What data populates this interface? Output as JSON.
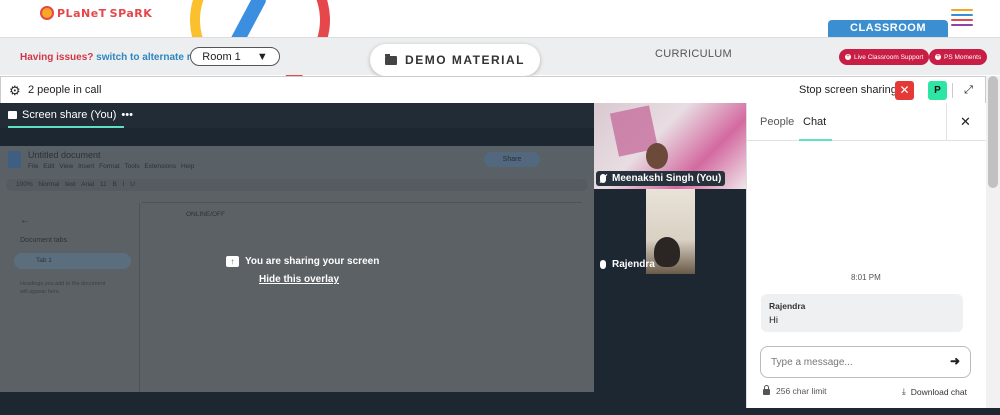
{
  "brand": {
    "logo_text_1": "PLaNeT",
    "logo_text_2": "SPaRK"
  },
  "header": {
    "classroom_tab": "CLASSROOM",
    "issues_text": "Having issues?",
    "alternate_room_link": "switch to alternate room",
    "room_select_value": "Room 1",
    "demo_material_label": "DEMO MATERIAL",
    "curriculum_label": "CURRICULUM",
    "live_support_label": "Live Classroom Support",
    "ps_moments_label": "PS Moments",
    "hamburger_colors": [
      "#f5a623",
      "#3b8ed0",
      "#e5474b",
      "#8e44ad"
    ]
  },
  "call_bar": {
    "people_count": "2 people in call",
    "stop_sharing_label": "Stop screen sharing",
    "participant_initial": "P"
  },
  "screen_share": {
    "tab_label": "Screen share (You)",
    "overlay_message": "You are sharing your screen",
    "hide_overlay_label": "Hide this overlay",
    "doc": {
      "title": "Untitled document",
      "menu": "File Edit View Insert Format Tools Extensions Help",
      "share_label": "Share",
      "toolbar": "100% Normal text Arial 11 B I U",
      "document_tabs_label": "Document tabs",
      "tab_1": "Tab 1",
      "outline_hint": "Headings you add to the document will appear here.",
      "body_text": "ONLINE/OFF"
    }
  },
  "participants": [
    {
      "name": "Meenakshi Singh (You)",
      "mic": "off"
    },
    {
      "name": "Rajendra",
      "mic": "on"
    }
  ],
  "side_panel": {
    "tab_people": "People",
    "tab_chat": "Chat",
    "active_tab": "Chat",
    "chat_time": "8:01 PM",
    "messages": [
      {
        "sender": "Rajendra",
        "text": "Hi"
      }
    ],
    "input_placeholder": "Type a message...",
    "char_limit": "256 char limit",
    "download_label": "Download chat"
  },
  "colors": {
    "accent": "#5fe0c3",
    "brand_red": "#e5474b",
    "support_pill": "#c81e45",
    "dark_bg": "#1d2732"
  }
}
